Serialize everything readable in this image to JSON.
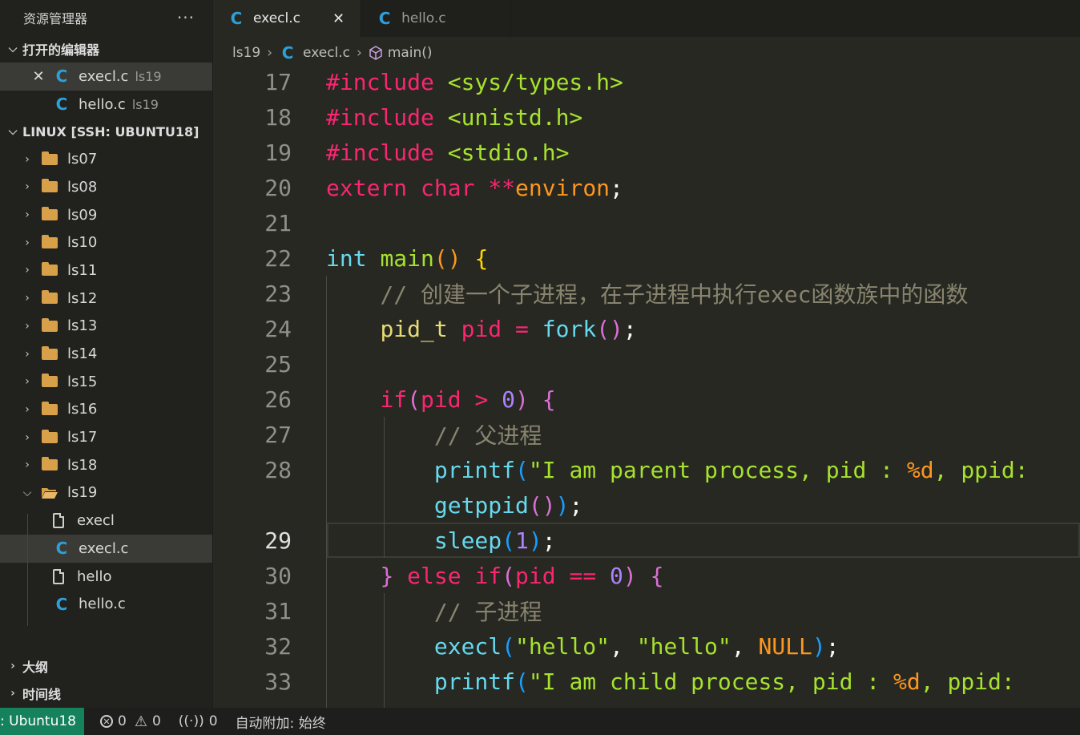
{
  "sidebar": {
    "title": "资源管理器",
    "more": "···",
    "open_editors": {
      "label": "打开的编辑器",
      "items": [
        {
          "name": "execl.c",
          "folder": "ls19"
        },
        {
          "name": "hello.c",
          "folder": "ls19"
        }
      ]
    },
    "workspace": {
      "label": "LINUX [SSH: UBUNTU18]",
      "folders": [
        "ls07",
        "ls08",
        "ls09",
        "ls10",
        "ls11",
        "ls12",
        "ls13",
        "ls14",
        "ls15",
        "ls16",
        "ls17",
        "ls18"
      ],
      "open_folder": "ls19",
      "files": [
        "execl",
        "execl.c",
        "hello",
        "hello.c"
      ]
    },
    "outline": "大纲",
    "timeline": "时间线"
  },
  "tabs": [
    {
      "label": "execl.c",
      "active": true
    },
    {
      "label": "hello.c",
      "active": false
    }
  ],
  "breadcrumb": [
    "ls19",
    "execl.c",
    "main()"
  ],
  "editor": {
    "line_numbers": [
      "17",
      "18",
      "19",
      "20",
      "21",
      "22",
      "23",
      "24",
      "25",
      "26",
      "27",
      "28",
      "",
      "29",
      "30",
      "31",
      "32",
      "33"
    ],
    "current_line": "29"
  },
  "statusbar": {
    "remote": ": Ubuntu18",
    "errors": "0",
    "warnings": "0",
    "ports": "0",
    "auto_attach": "自动附加: 始终"
  },
  "colors": {
    "background": "#272822",
    "sidebar": "#21221d",
    "remote": "#16825d",
    "c_icon": "#2f9fd8"
  }
}
